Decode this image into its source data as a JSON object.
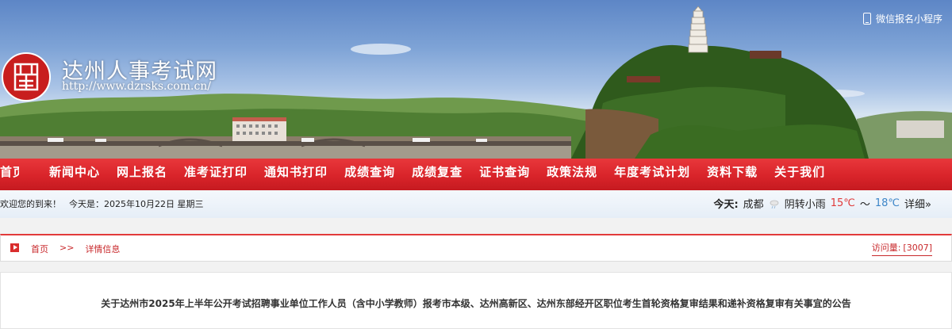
{
  "header": {
    "site_title": "达州人事考试网",
    "site_url": "http://www.dzrsks.com.cn/",
    "mini_program_label": "微信报名小程序",
    "logo_icon": "seal-logo-icon"
  },
  "nav": {
    "first_item": "首页",
    "items": [
      "新闻中心",
      "网上报名",
      "准考证打印",
      "通知书打印",
      "成绩查询",
      "成绩复查",
      "证书查询",
      "政策法规",
      "年度考试计划",
      "资料下载",
      "关于我们"
    ]
  },
  "welcome": {
    "greeting": "欢迎您的到来！",
    "date_prefix": "今天是：",
    "date": "2025年10月22日 星期三"
  },
  "weather": {
    "today_label": "今天:",
    "city": "成都",
    "condition": "阴转小雨",
    "high": "15℃",
    "separator": "～",
    "low": "18℃",
    "details": "详细»"
  },
  "breadcrumb": {
    "home": "首页",
    "separator": ">>",
    "current": "详情信息"
  },
  "visits": {
    "label": "访问量:",
    "count": "[3007]"
  },
  "article": {
    "title": "关于达州市2025年上半年公开考试招聘事业单位工作人员（含中小学教师）报考市本级、达州高新区、达州东部经开区职位考生首轮资格复审结果和递补资格复审有关事宜的公告"
  },
  "colors": {
    "brand_red": "#d9242a",
    "temp_high": "#e03a3a",
    "temp_low": "#3d86c8"
  }
}
